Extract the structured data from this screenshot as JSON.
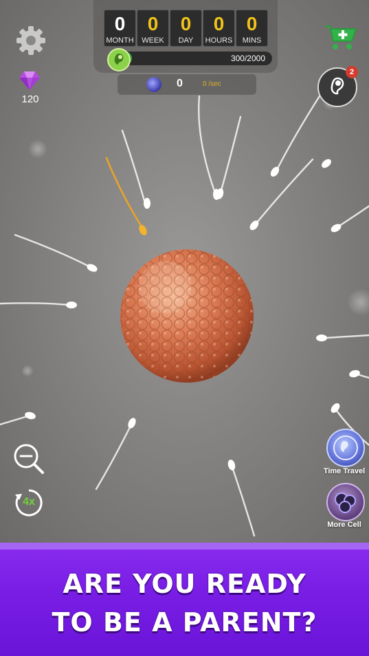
{
  "timer": {
    "units": [
      {
        "value": "0",
        "label": "MONTH",
        "color": "#ffffff"
      },
      {
        "value": "0",
        "label": "WEEK",
        "color": "#f0c21a"
      },
      {
        "value": "0",
        "label": "DAY",
        "color": "#f0c21a"
      },
      {
        "value": "0",
        "label": "HOURS",
        "color": "#f0c21a"
      },
      {
        "value": "0",
        "label": "MINS",
        "color": "#f0c21a"
      }
    ]
  },
  "progress": {
    "current": "300",
    "max": "/2000",
    "fraction": 0.15
  },
  "rate": {
    "count": "0",
    "per_sec_value": "0",
    "per_sec_unit": "/sec"
  },
  "gems": {
    "count": "120",
    "icon": "diamond-icon"
  },
  "baby": {
    "badge": "2"
  },
  "buttons": {
    "time_travel": "Time Travel",
    "more_cell": "More Cell",
    "speed": "4x"
  },
  "banner": {
    "line1": "ARE YOU READY",
    "line2": "TO BE A PARENT?"
  },
  "colors": {
    "accent_green": "#3aa13a",
    "banner_purple": "#7a1ee6",
    "egg": "#d97a55"
  }
}
